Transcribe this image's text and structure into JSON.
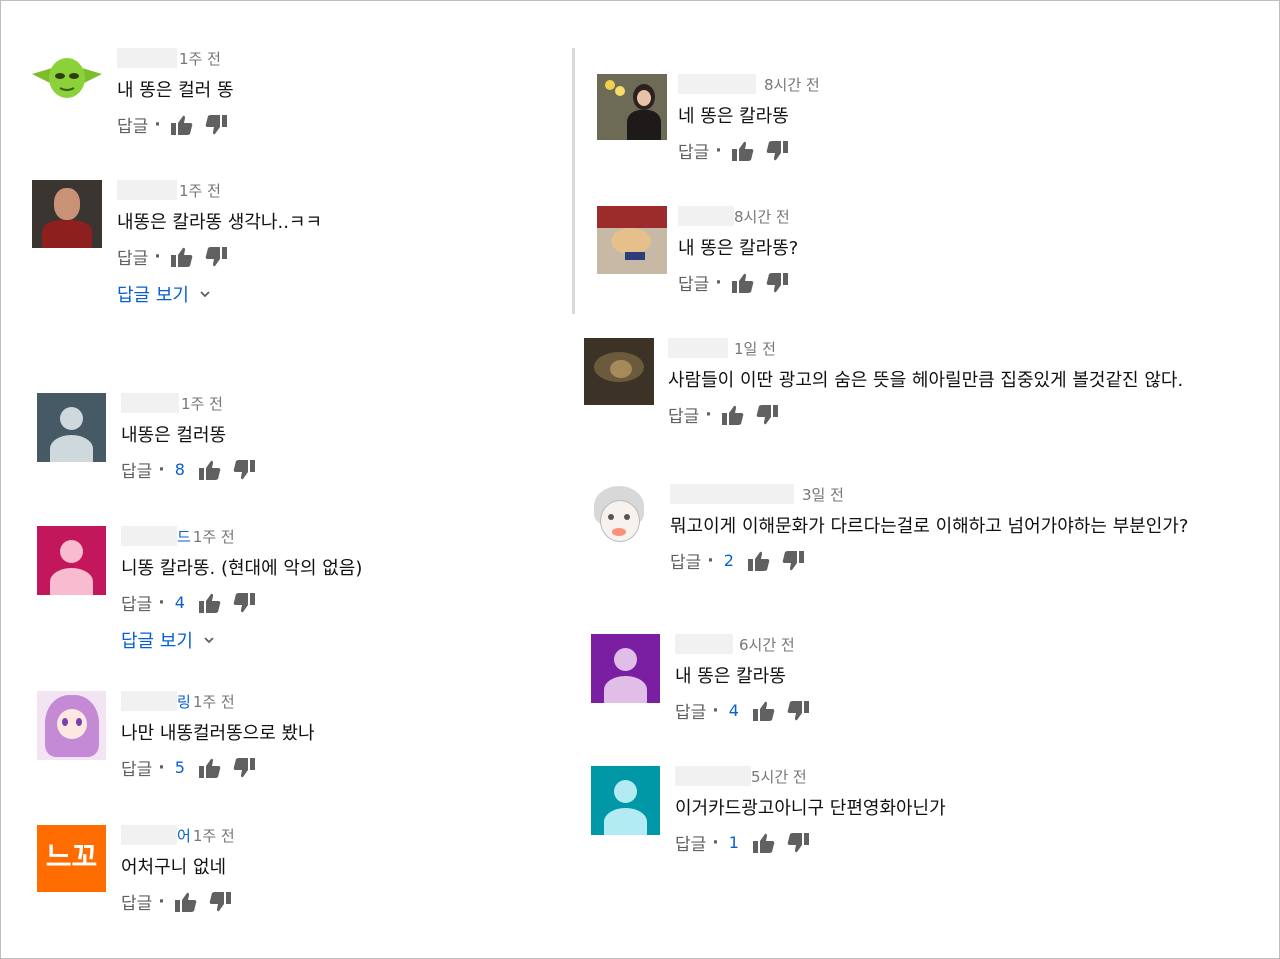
{
  "labels": {
    "reply": "답글",
    "dot": "·",
    "view_replies": "답글 보기"
  },
  "icons": {
    "like": "thumb-up-icon",
    "dislike": "thumb-down-icon",
    "expand": "chevron-down-icon"
  },
  "colors": {
    "link": "#065fd4",
    "meta": "#777777",
    "icon": "#606060"
  },
  "left_comments": [
    {
      "time": "1주 전",
      "text": "내 똥은 컬러 똥",
      "count": null,
      "view_replies": false
    },
    {
      "time": "1주 전",
      "text": "내똥은 칼라똥 생각나..ㅋㅋ",
      "count": null,
      "view_replies": true
    },
    {
      "name_fragment": "",
      "time": "1주 전",
      "text": "내똥은 컬러똥",
      "count": "8",
      "view_replies": false
    },
    {
      "name_fragment": "드",
      "time": "1주 전",
      "text": "니똥 칼라똥. (현대에 악의 없음)",
      "count": "4",
      "view_replies": true
    },
    {
      "name_fragment": "링",
      "time": "1주 전",
      "text": "나만 내똥컬러똥으로 봤나",
      "count": "5",
      "view_replies": false
    },
    {
      "name_fragment": "어",
      "time": "1주 전",
      "text": "어처구니 없네",
      "count": null,
      "view_replies": false,
      "avatar_text": "느꼬"
    }
  ],
  "right_comments": [
    {
      "time": "8시간 전",
      "text": "네 똥은 칼라똥",
      "count": null
    },
    {
      "time": "8시간 전",
      "text": "내 똥은 칼라똥?",
      "count": null
    },
    {
      "time": "1일 전",
      "text": "사람들이 이딴 광고의 숨은 뜻을 헤아릴만큼 집중있게 볼것같진 않다.",
      "count": null
    },
    {
      "time": "3일 전",
      "text": "뭐고이게 이해문화가 다르다는걸로 이해하고 넘어가야하는 부분인가?",
      "count": "2"
    },
    {
      "time": "6시간 전",
      "text": "내 똥은 칼라똥",
      "count": "4"
    },
    {
      "time": "5시간 전",
      "text": "이거카드광고아니구 단편영화아닌가",
      "count": "1"
    }
  ]
}
